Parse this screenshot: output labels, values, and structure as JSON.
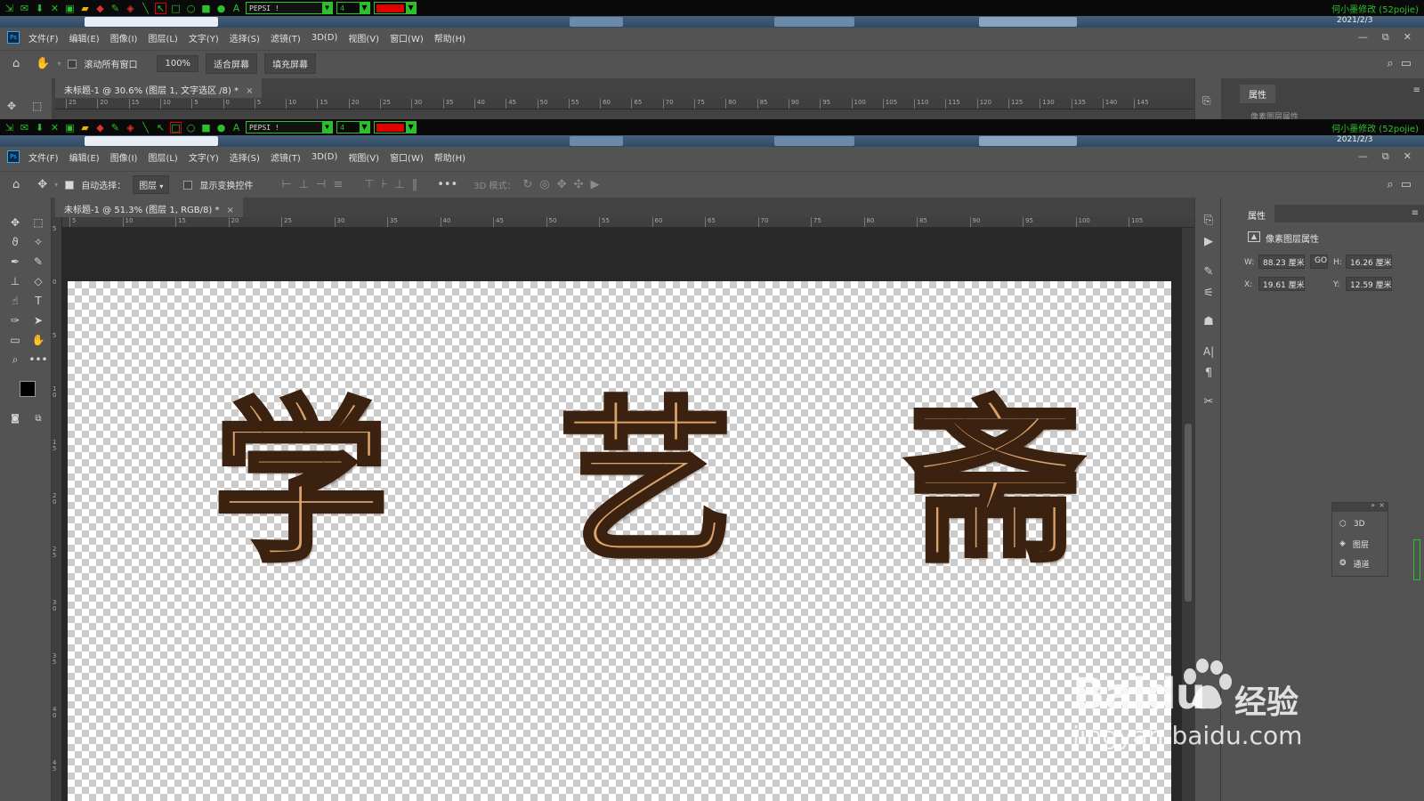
{
  "capture_toolbar": {
    "font_select": "PEPSI !",
    "size_select": "4",
    "credit": "何小墨修改 (52pojie)",
    "date": "2021/2/3"
  },
  "menu": {
    "items": [
      "文件(F)",
      "编辑(E)",
      "图像(I)",
      "图层(L)",
      "文字(Y)",
      "选择(S)",
      "滤镜(T)",
      "3D(D)",
      "视图(V)",
      "窗口(W)",
      "帮助(H)"
    ],
    "win_min": "—",
    "win_restore": "⧉",
    "win_close": "✕"
  },
  "top_window": {
    "options": {
      "scroll_all": "滚动所有窗口",
      "zoom": "100%",
      "fit_screen": "适合屏幕",
      "fill_screen": "填充屏幕"
    },
    "doc_tab": "未标题-1 @ 30.6% (图层 1, 文字选区 /8) *",
    "ruler_ticks": [
      "25",
      "20",
      "15",
      "10",
      "5",
      "0",
      "5",
      "10",
      "15",
      "20",
      "25",
      "30",
      "35",
      "40",
      "45",
      "50",
      "55",
      "60",
      "65",
      "70",
      "75",
      "80",
      "85",
      "90",
      "95",
      "100",
      "105",
      "110",
      "115",
      "120",
      "125",
      "130",
      "135",
      "140",
      "145"
    ],
    "props_tab": "属性",
    "props_sub": "像素图层属性"
  },
  "main_window": {
    "options": {
      "auto_select": "自动选择：",
      "layer_select": "图层",
      "show_transform": "显示变换控件",
      "mode_3d": "3D 模式："
    },
    "doc_tab": "未标题-1 @ 51.3% (图层 1, RGB/8) *",
    "ruler_ticks": [
      "5",
      "10",
      "15",
      "20",
      "25",
      "30",
      "35",
      "40",
      "45",
      "50",
      "55",
      "60",
      "65",
      "70",
      "75",
      "80",
      "85",
      "90",
      "95",
      "100",
      "105"
    ],
    "vruler_ticks": [
      "5",
      "0",
      "5",
      "1 0",
      "1 5",
      "2 0",
      "2 5",
      "3 0",
      "3 5",
      "4 0",
      "4 5"
    ],
    "canvas_text": [
      "学",
      "艺",
      "斋"
    ]
  },
  "properties": {
    "tab": "属性",
    "title": "像素图层属性",
    "w_label": "W:",
    "w_value": "88.23 厘米",
    "link": "GO",
    "h_label": "H:",
    "h_value": "16.26 厘米",
    "x_label": "X:",
    "x_value": "19.61 厘米",
    "y_label": "Y:",
    "y_value": "12.59 厘米"
  },
  "float_panel": {
    "items": [
      "3D",
      "图层",
      "通道"
    ]
  },
  "watermark": {
    "brand": "Baidu",
    "suffix": "经验",
    "url": "jingyan.baidu.com"
  },
  "colors": {
    "accent_green": "#2dbf2d",
    "capture_red": "#e00000",
    "ps_blue": "#31a8ff",
    "panel_bg": "#535353"
  }
}
